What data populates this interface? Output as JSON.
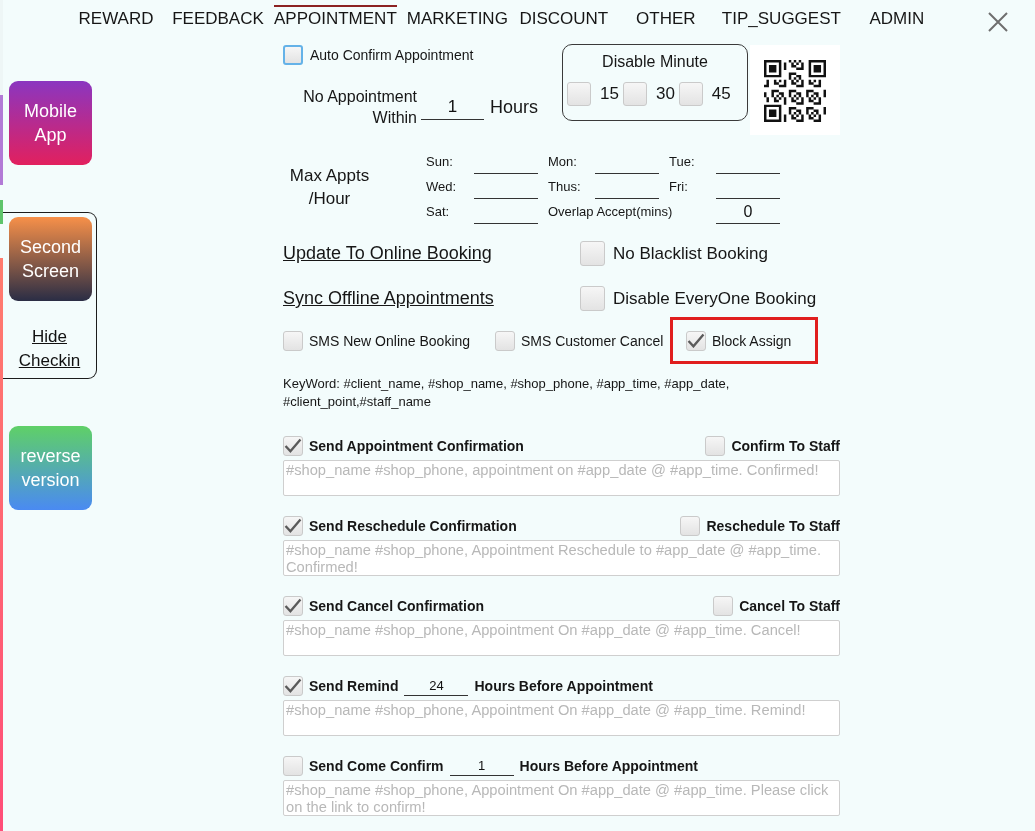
{
  "tabs": [
    {
      "label": "REWARD",
      "selected": false
    },
    {
      "label": "FEEDBACK",
      "selected": false
    },
    {
      "label": "APPOINTMENT",
      "selected": true
    },
    {
      "label": "MARKETING",
      "selected": false
    },
    {
      "label": "DISCOUNT",
      "selected": false
    },
    {
      "label": "OTHER",
      "selected": false
    },
    {
      "label": "TIP_SUGGEST",
      "selected": false
    },
    {
      "label": "ADMIN",
      "selected": false
    }
  ],
  "sidebar": {
    "mobile_app_button": "Mobile App",
    "checkin_panel": {
      "second_screen_button": "Second Screen",
      "hide_checkin_link": "Hide Checkin"
    },
    "reverse_version_button": "reverse version"
  },
  "auto_confirm": {
    "label": "Auto Confirm Appointment",
    "checked": false,
    "focused": true
  },
  "no_appointment": {
    "label": "No Appointment Within",
    "value": "1",
    "unit": "Hours"
  },
  "disable_minute": {
    "title": "Disable Minute",
    "options": [
      {
        "label": "15",
        "checked": false
      },
      {
        "label": "30",
        "checked": false
      },
      {
        "label": "45",
        "checked": false
      }
    ]
  },
  "max_appts": {
    "label": "Max Appts /Hour",
    "fields": [
      {
        "kind": "day",
        "label": "Sun:"
      },
      {
        "kind": "day",
        "label": "Mon:"
      },
      {
        "kind": "day",
        "label": "Tue:"
      },
      {
        "kind": "day",
        "label": "Wed:"
      },
      {
        "kind": "day",
        "label": "Thus:"
      },
      {
        "kind": "day",
        "label": "Fri:"
      },
      {
        "kind": "day",
        "label": "Sat:"
      },
      {
        "kind": "overlap",
        "label": "Overlap Accept(mins)",
        "value": "0"
      }
    ]
  },
  "booking_links": [
    {
      "link": "Update To Online Booking",
      "option": {
        "label": "No Blacklist Booking",
        "checked": false
      }
    },
    {
      "link": "Sync Offline Appointments",
      "option": {
        "label": "Disable EveryOne Booking",
        "checked": false
      }
    }
  ],
  "sms_options": [
    {
      "label": "SMS New Online Booking",
      "checked": false,
      "highlighted": false
    },
    {
      "label": "SMS Customer Cancel",
      "checked": false,
      "highlighted": false
    },
    {
      "label": "Block Assign",
      "checked": true,
      "highlighted": true
    }
  ],
  "keyword_hint": "KeyWord: #client_name, #shop_name, #shop_phone, #app_time, #app_date, #client_point,#staff_name",
  "messages": [
    {
      "kind": "staff",
      "label": "Send Appointment Confirmation",
      "checked": true,
      "staff_option": {
        "label": "Confirm To Staff",
        "checked": false
      },
      "placeholder": "#shop_name #shop_phone, appointment on #app_date @ #app_time. Confirmed!"
    },
    {
      "kind": "staff",
      "label": "Send Reschedule Confirmation",
      "checked": true,
      "staff_option": {
        "label": "Reschedule To Staff",
        "checked": false
      },
      "placeholder": "#shop_name #shop_phone, Appointment Reschedule to #app_date @ #app_time. Confirmed!"
    },
    {
      "kind": "staff",
      "label": "Send Cancel Confirmation",
      "checked": true,
      "staff_option": {
        "label": "Cancel To Staff",
        "checked": false
      },
      "placeholder": "#shop_name #shop_phone, Appointment On #app_date @ #app_time. Cancel!"
    },
    {
      "kind": "hours",
      "label": "Send Remind",
      "checked": true,
      "hours": "24",
      "suffix": "Hours Before Appointment",
      "placeholder": "#shop_name #shop_phone, Appointment On #app_date @ #app_time. Remind!"
    },
    {
      "kind": "hours",
      "label": "Send Come Confirm",
      "checked": false,
      "hours": "1",
      "suffix": "Hours Before Appointment",
      "placeholder": "#shop_name #shop_phone, Appointment On #app_date @ #app_time. Please click on the link to confirm!"
    }
  ]
}
